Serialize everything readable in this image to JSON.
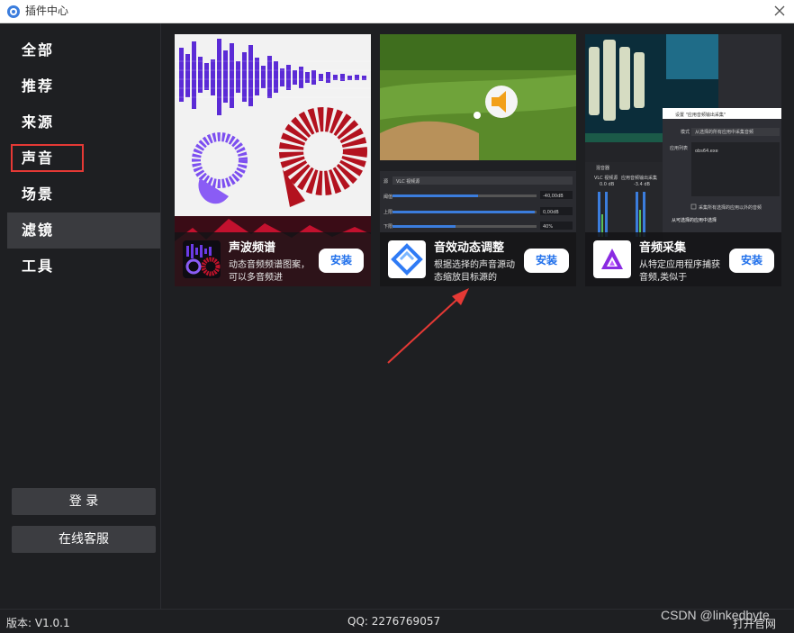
{
  "window": {
    "title": "插件中心"
  },
  "sidebar": {
    "items": [
      {
        "label": "全部"
      },
      {
        "label": "推荐"
      },
      {
        "label": "来源"
      },
      {
        "label": "声音"
      },
      {
        "label": "场景"
      },
      {
        "label": "滤镜"
      },
      {
        "label": "工具"
      }
    ],
    "active_item": "滤镜",
    "highlighted_item": "声音",
    "login_label": "登 录",
    "support_label": "在线客服"
  },
  "plugins": [
    {
      "name": "声波频谱",
      "description": "动态音频频谱图案，可以多音频进",
      "install_label": "安装"
    },
    {
      "name": "音效动态调整",
      "description": "根据选择的声音源动态缩放目标源的",
      "install_label": "安装",
      "preview_text": {
        "source_label": "源",
        "source_value": "VLC 视频源",
        "threshold_label": "阈值",
        "threshold_value": "-40,00dB",
        "upper_label": "上限",
        "upper_value": "0,00dB",
        "lower_label": "下限",
        "lower_value": "40%"
      }
    },
    {
      "name": "音频采集",
      "description": "从特定应用程序捕获音频,类似于",
      "install_label": "安装",
      "preview_text": {
        "mixer": "混音器",
        "vlc": "VLC 视频源",
        "app_audio": "应用音频输出采集",
        "db1": "0.0 dB",
        "db2": "-3.4 dB",
        "dialog_title": "设置 \"应用音频输出采集\"",
        "mode_label": "模式",
        "mode_value": "从选择的所有应用中采集音频",
        "app_list_label": "应用列表",
        "app_list_value": "obs64.exe",
        "checkbox_label": "采集所有选择的应用以外的音频",
        "section_label": "从可选择的应用中选择"
      }
    }
  ],
  "statusbar": {
    "version": "版本: V1.0.1",
    "qq": "QQ: 2276769057",
    "official_site": "打开官网"
  },
  "watermark": "CSDN @linkedbyte",
  "colors": {
    "background": "#1e1f22",
    "active_nav": "#3a3b3f",
    "highlight_border": "#e53935",
    "install_text": "#1f6feb",
    "annotation_arrow": "#e53935"
  }
}
